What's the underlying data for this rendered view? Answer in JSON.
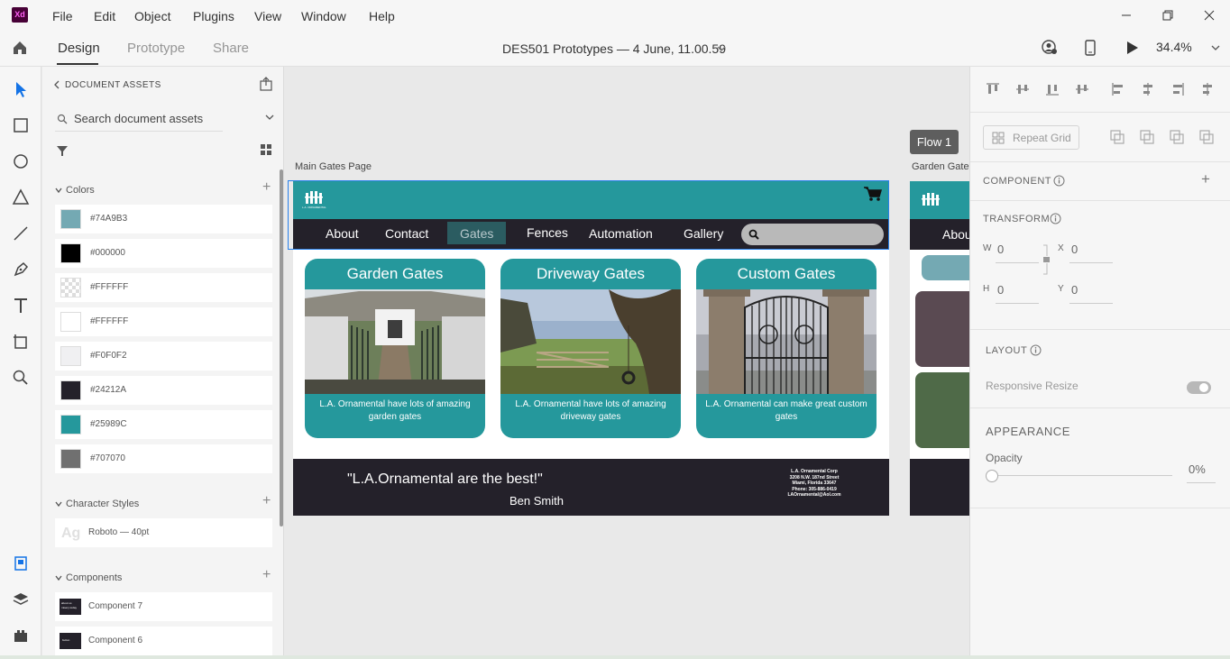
{
  "app": {
    "icon_text": "Xd"
  },
  "menu": [
    "File",
    "Edit",
    "Object",
    "Plugins",
    "View",
    "Window",
    "Help"
  ],
  "modes": {
    "design": "Design",
    "prototype": "Prototype",
    "share": "Share"
  },
  "document_title": "DES501 Prototypes — 4 June, 11.00.59",
  "zoom": "34.4%",
  "assets": {
    "title": "DOCUMENT ASSETS",
    "search_placeholder": "Search document assets",
    "colors_label": "Colors",
    "colors": [
      {
        "hex": "#74A9B3",
        "label": "#74A9B3"
      },
      {
        "hex": "#000000",
        "label": "#000000"
      },
      {
        "hex": "#FFFFFF",
        "label": "#FFFFFF",
        "transparent": true
      },
      {
        "hex": "#FFFFFF",
        "label": "#FFFFFF"
      },
      {
        "hex": "#F0F0F2",
        "label": "#F0F0F2"
      },
      {
        "hex": "#24212A",
        "label": "#24212A"
      },
      {
        "hex": "#25989C",
        "label": "#25989C"
      },
      {
        "hex": "#707070",
        "label": "#707070"
      }
    ],
    "character_styles_label": "Character Styles",
    "char_style": {
      "preview": "Ag",
      "name": "Roboto — 40pt"
    },
    "components_label": "Components",
    "components": [
      {
        "name": "Component 7",
        "thumb_text": "about us\nmisery today"
      },
      {
        "name": "Component 6",
        "thumb_text": "button"
      }
    ]
  },
  "canvas": {
    "artboard_label": "Main Gates Page",
    "artboard2_label": "Garden Gates",
    "flow_label": "Flow 1",
    "logo_text": "L.A. ORNAMENTAL",
    "nav": [
      "About",
      "Contact",
      "Gates",
      "Fences",
      "Automation",
      "Gallery"
    ],
    "active_nav": "Gates",
    "artboard2_nav": "Abou",
    "cards": [
      {
        "title": "Garden Gates",
        "desc": "L.A. Ornamental have lots of amazing garden gates"
      },
      {
        "title": "Driveway Gates",
        "desc": "L.A. Ornamental have lots of amazing driveway gates"
      },
      {
        "title": "Custom Gates",
        "desc": "L.A. Ornamental can make great custom gates"
      }
    ],
    "quote": "\"L.A.Ornamental are the best!\"",
    "quote_author": "Ben Smith",
    "contact": [
      "L.A. Ornamental Corp",
      "3208 N.W. 187nd Street",
      "Miami, Florida 33647",
      "Phone: 305-886-0419",
      "LAOrnamental@Aol.com"
    ]
  },
  "props": {
    "repeat_grid": "Repeat Grid",
    "component": "COMPONENT",
    "transform": "TRANSFORM",
    "w_label": "W",
    "w": "0",
    "x_label": "X",
    "x": "0",
    "h_label": "H",
    "h": "0",
    "y_label": "Y",
    "y": "0",
    "layout": "LAYOUT",
    "responsive_resize": "Responsive Resize",
    "appearance": "APPEARANCE",
    "opacity_label": "Opacity",
    "opacity": "0%"
  },
  "colors": {
    "teal": "#25989c",
    "dark": "#24212a",
    "accent": "#74a9b3",
    "selection": "#2680eb"
  }
}
